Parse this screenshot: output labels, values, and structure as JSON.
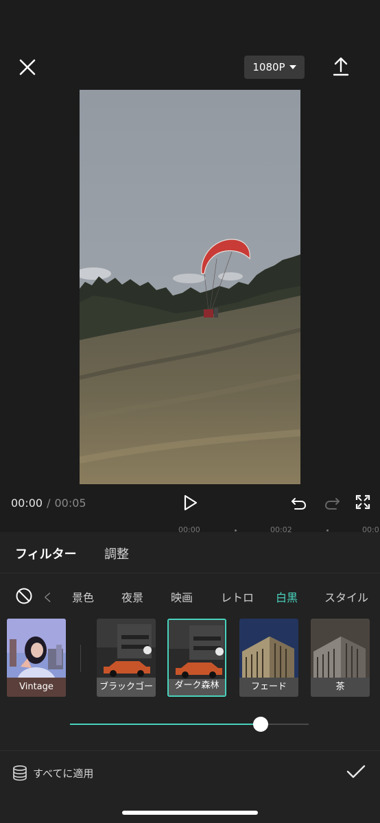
{
  "header": {
    "resolution": "1080P"
  },
  "playback": {
    "current": "00:00",
    "separator": "/",
    "total": "00:05"
  },
  "ruler": {
    "ticks": [
      "00:00",
      "00:02",
      "00:0"
    ]
  },
  "panel": {
    "tabs": [
      "フィルター",
      "調整"
    ]
  },
  "categories": {
    "partial": "く",
    "items": [
      "景色",
      "夜景",
      "映画",
      "レトロ",
      "白黒",
      "スタイル"
    ],
    "active": "白黒"
  },
  "filters": {
    "items": [
      "Vintage",
      "ブラックゴー",
      "ダーク森林",
      "フェード",
      "茶"
    ],
    "selected": "ダーク森林"
  },
  "intensity": {
    "value": 0.8
  },
  "footer": {
    "apply_all": "すべてに適用"
  },
  "colors": {
    "accent": "#49d3bd",
    "background": "#1c1c1c",
    "panel": "#222222"
  },
  "icons": [
    "close-icon",
    "caret-down-icon",
    "export-icon",
    "play-icon",
    "undo-icon",
    "redo-icon",
    "fullscreen-icon",
    "no-filter-icon",
    "stack-icon",
    "check-icon"
  ]
}
